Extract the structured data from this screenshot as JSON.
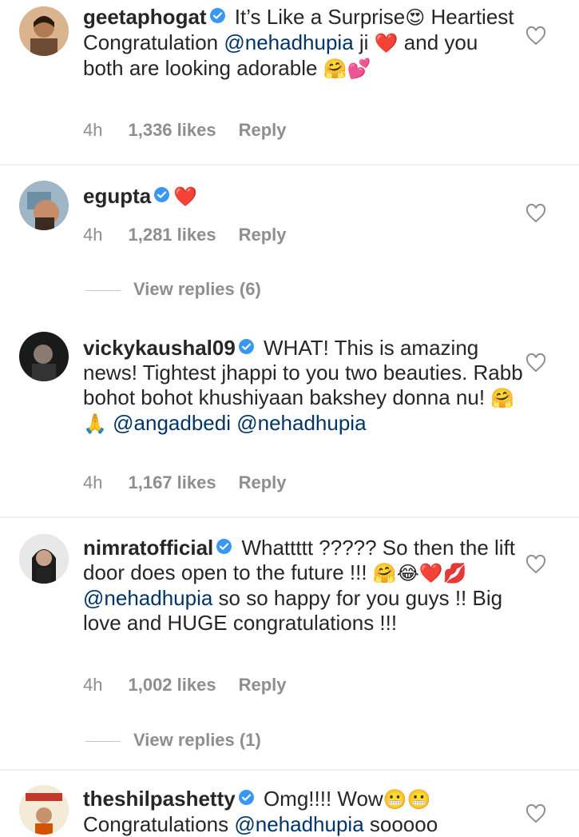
{
  "comments": [
    {
      "username": "geetaphogat",
      "text_segments": [
        {
          "t": " It’s Like a Surprise"
        },
        {
          "e": "😍"
        },
        {
          "t": " Heartiest Congratulation "
        },
        {
          "m": "@nehadhupia"
        },
        {
          "t": " ji "
        },
        {
          "e": "❤️"
        },
        {
          "t": " and you both are looking adorable "
        },
        {
          "e": "🤗💕"
        }
      ],
      "time": "4h",
      "likes": "1,336 likes",
      "reply": "Reply"
    },
    {
      "username": "egupta",
      "text_segments": [
        {
          "e": "❤️"
        }
      ],
      "time": "4h",
      "likes": "1,281 likes",
      "reply": "Reply",
      "view_replies": "View replies (6)"
    },
    {
      "username": "vickykaushal09",
      "text_segments": [
        {
          "t": " WHAT! This is amazing news! Tightest jhappi to you two beauties. Rabb bohot bohot khushiyaan bakshey donna nu! "
        },
        {
          "e": "🤗🙏"
        },
        {
          "t": " "
        },
        {
          "m": "@angadbedi"
        },
        {
          "t": " "
        },
        {
          "m": "@nehadhupia"
        }
      ],
      "time": "4h",
      "likes": "1,167 likes",
      "reply": "Reply"
    },
    {
      "username": "nimratofficial",
      "text_segments": [
        {
          "t": " Whattttt ????? So then the lift door does open to the future !!! "
        },
        {
          "e": "🤗😂❤️💋"
        },
        {
          "t": " "
        },
        {
          "m": "@nehadhupia"
        },
        {
          "t": " so so happy for you guys !! Big love and HUGE congratulations !!!"
        }
      ],
      "time": "4h",
      "likes": "1,002 likes",
      "reply": "Reply",
      "view_replies": "View replies (1)"
    },
    {
      "username": "theshilpashetty",
      "text_segments": [
        {
          "t": " Omg!!!! Wow"
        },
        {
          "e": "😬😬"
        },
        {
          "t": " Congratulations "
        },
        {
          "m": "@nehadhupia"
        },
        {
          "t": " sooooo"
        }
      ]
    }
  ],
  "colors": {
    "accent": "#3897f0",
    "mention": "#003569",
    "meta": "#8e8e8e",
    "heart": "#e0245e"
  },
  "icons": {
    "verified": "verified-badge-icon",
    "like": "heart-outline-icon"
  }
}
